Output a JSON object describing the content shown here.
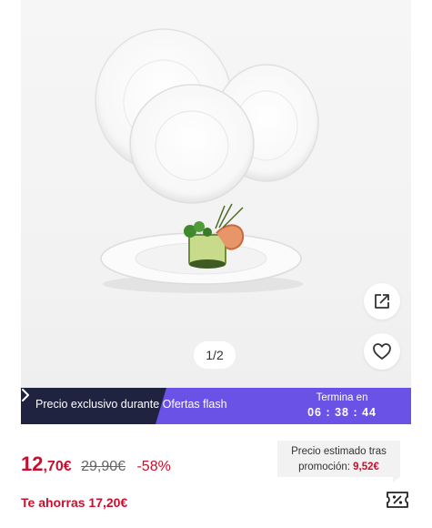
{
  "product_image": {
    "pager": "1/2",
    "share_icon": "share-external-icon",
    "favorite_icon": "heart-outline-icon"
  },
  "flash_sale": {
    "label": "Precio exclusivo durante Ofertas flash",
    "ends_label": "Termina en",
    "countdown": "06 : 38 : 44",
    "colors": {
      "dark": "#1f2340",
      "purple": "#6b52e6"
    }
  },
  "price": {
    "current_int": "12",
    "current_dec": ",70€",
    "original": "29,90€",
    "discount": "-58%",
    "color": "#c8102e"
  },
  "estimate": {
    "text": "Precio estimado tras promoción:",
    "value": "9,52€"
  },
  "savings": {
    "text": "Te ahorras 17,20€"
  },
  "coupon": {
    "icon": "coupon-percent-icon"
  }
}
